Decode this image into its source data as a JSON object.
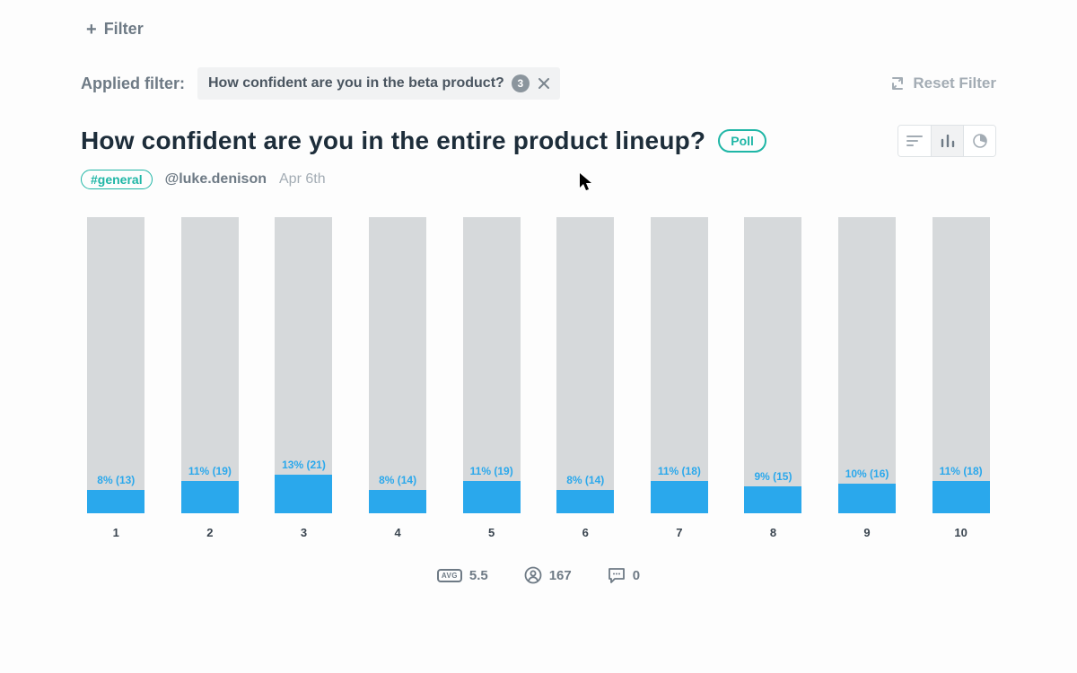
{
  "toolbar": {
    "add_filter_label": "Filter",
    "applied_label": "Applied filter:",
    "filter_chip": {
      "text": "How confident are you in the beta product?",
      "count": "3"
    },
    "reset_label": "Reset Filter"
  },
  "question": {
    "title": "How confident are you in the entire product lineup?",
    "type_label": "Poll",
    "channel": "#general",
    "author": "@luke.denison",
    "date": "Apr 6th"
  },
  "footer": {
    "avg": "5.5",
    "respondents": "167",
    "comments": "0"
  },
  "chart_data": {
    "type": "bar",
    "title": "How confident are you in the entire product lineup?",
    "xlabel": "",
    "ylabel": "",
    "ylim": [
      0,
      100
    ],
    "categories": [
      "1",
      "2",
      "3",
      "4",
      "5",
      "6",
      "7",
      "8",
      "9",
      "10"
    ],
    "series": [
      {
        "name": "percent",
        "values": [
          8,
          11,
          13,
          8,
          11,
          8,
          11,
          9,
          10,
          11
        ]
      },
      {
        "name": "count",
        "values": [
          13,
          19,
          21,
          14,
          19,
          14,
          18,
          15,
          16,
          18
        ]
      }
    ]
  }
}
